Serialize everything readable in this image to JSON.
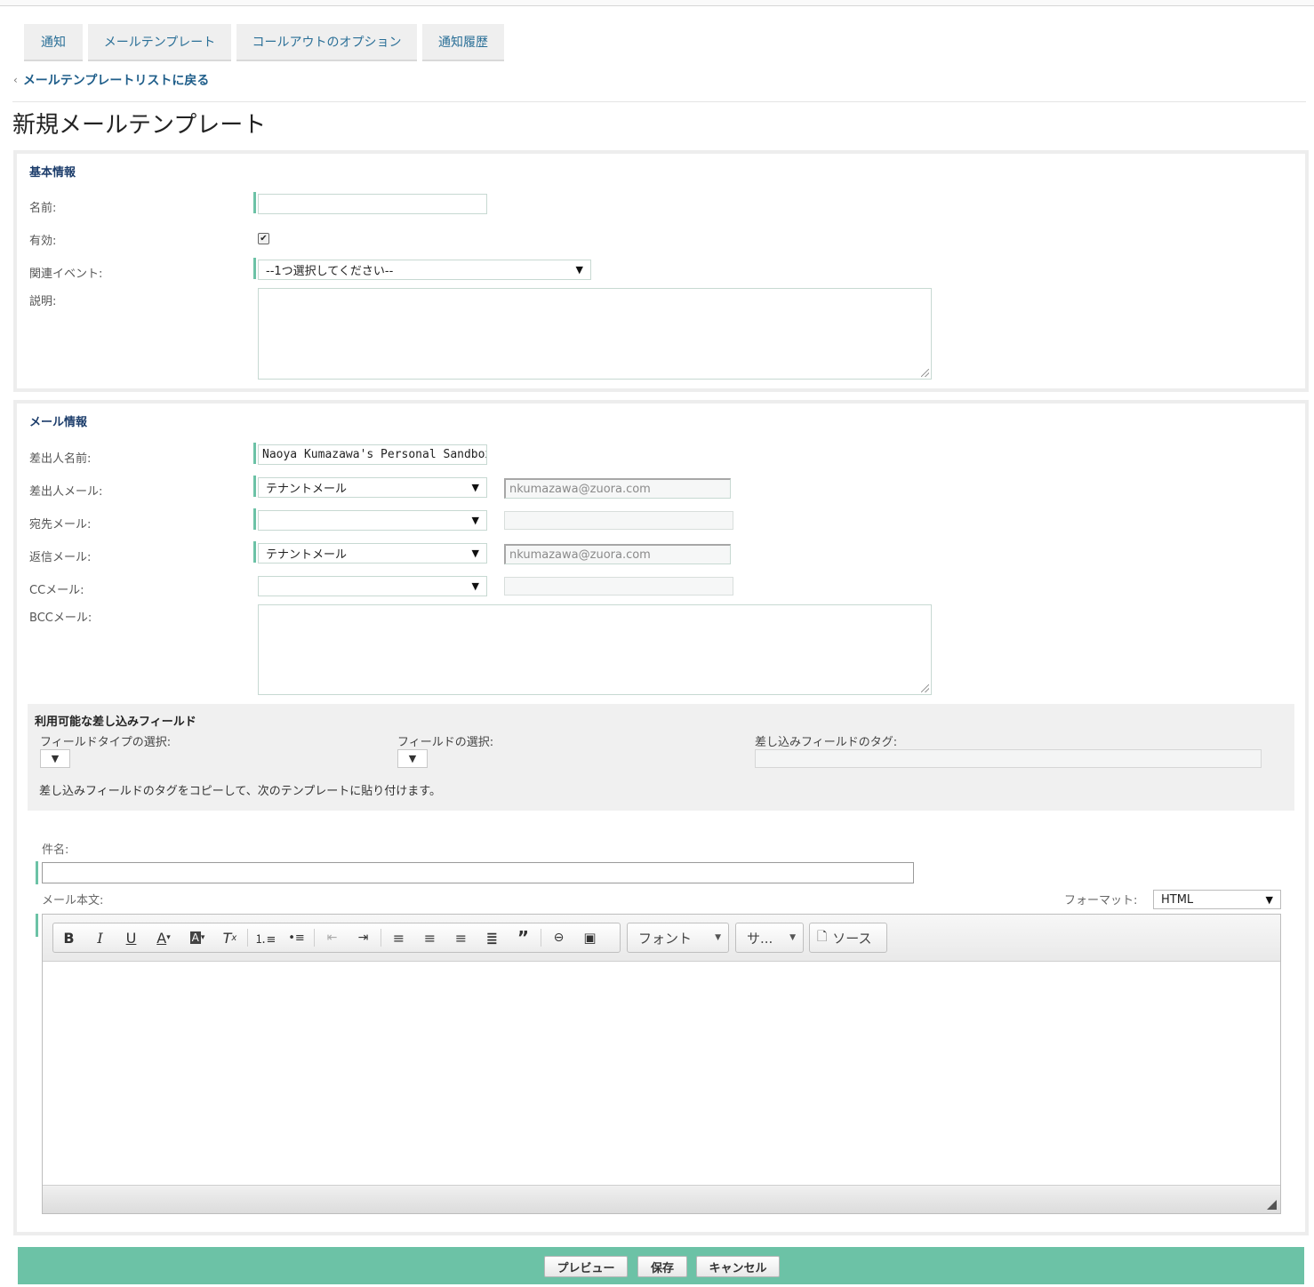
{
  "tabs": [
    {
      "label": "通知"
    },
    {
      "label": "メールテンプレート"
    },
    {
      "label": "コールアウトのオプション"
    },
    {
      "label": "通知履歴"
    }
  ],
  "back_link": "メールテンプレートリストに戻る",
  "page_title": "新規メールテンプレート",
  "basic": {
    "title": "基本情報",
    "name_label": "名前:",
    "name_value": "",
    "active_label": "有効:",
    "active_checked": true,
    "event_label": "関連イベント:",
    "event_value": "--1つ選択してください--",
    "desc_label": "説明:"
  },
  "mail": {
    "title": "メール情報",
    "from_name_label": "差出人名前:",
    "from_name_value": "Naoya Kumazawa's Personal Sandbox",
    "from_email_label": "差出人メール:",
    "from_email_select": "テナントメール",
    "from_email_value": "nkumazawa@zuora.com",
    "to_email_label": "宛先メール:",
    "to_email_select": "",
    "reply_email_label": "返信メール:",
    "reply_email_select": "テナントメール",
    "reply_email_value": "nkumazawa@zuora.com",
    "cc_label": "CCメール:",
    "cc_select": "",
    "bcc_label": "BCCメール:"
  },
  "merge": {
    "title": "利用可能な差し込みフィールド",
    "field_type_label": "フィールドタイプの選択:",
    "field_label": "フィールドの選択:",
    "tag_label": "差し込みフィールドのタグ:",
    "note": "差し込みフィールドのタグをコピーして、次のテンプレートに貼り付けます。"
  },
  "subject_label": "件名:",
  "body_label": "メール本文:",
  "format_label": "フォーマット:",
  "format_value": "HTML",
  "editor": {
    "font_combo": "フォント",
    "size_combo": "サ...",
    "source_label": "ソース"
  },
  "footer": {
    "preview": "プレビュー",
    "save": "保存",
    "cancel": "キャンセル"
  }
}
